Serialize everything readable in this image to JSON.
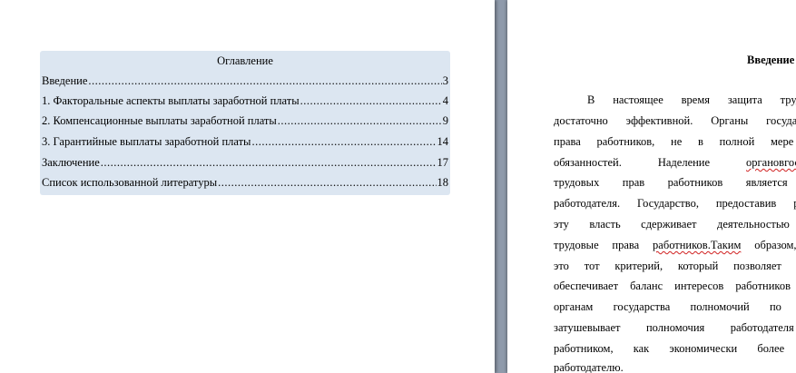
{
  "toc": {
    "title": "Оглавление",
    "entries": [
      {
        "label": "Введение",
        "page": "3"
      },
      {
        "label": "1. Факторальные аспекты выплаты заработной платы",
        "page": "4"
      },
      {
        "label": "2. Компенсационные выплаты заработной платы",
        "page": "9"
      },
      {
        "label": "3. Гарантийные выплаты заработной платы",
        "page": "14"
      },
      {
        "label": "Заключение",
        "page": "17"
      },
      {
        "label": "Список использованной литературы",
        "page": "18"
      }
    ]
  },
  "right_page": {
    "heading": "Введение",
    "lines": [
      "В настоящее время защита трудовых",
      "достаточно эффективной. Органы государства,",
      "права работников, не в полной мере обе",
      "обязанностей. Наделение органовгосударс",
      "трудовых прав работников является эле",
      "работодателя. Государство, предоставив работо",
      "эту власть сдерживает деятельностью орг",
      "трудовые права работников. Таким образом, дея",
      "это тот критерий, который позволяет сдерж",
      "обеспечивает баланс интересов работников и р",
      "органам государства полномочий по защи",
      "затушевывает полномочия работодателя и",
      "работником, как экономически более слаб",
      "работодателю."
    ],
    "line_parts": {
      "l3_a": "обязанностей. Наделение ",
      "l3_b": "органовгосударс",
      "l7_a": "трудовые права ",
      "l7_b": "работников.Таким",
      "l7_c": " образом, дея"
    }
  },
  "colors": {
    "background": "#8f9aab",
    "toc_fill": "#dce6f1",
    "page": "#ffffff",
    "spellcheck": "#d02020"
  }
}
